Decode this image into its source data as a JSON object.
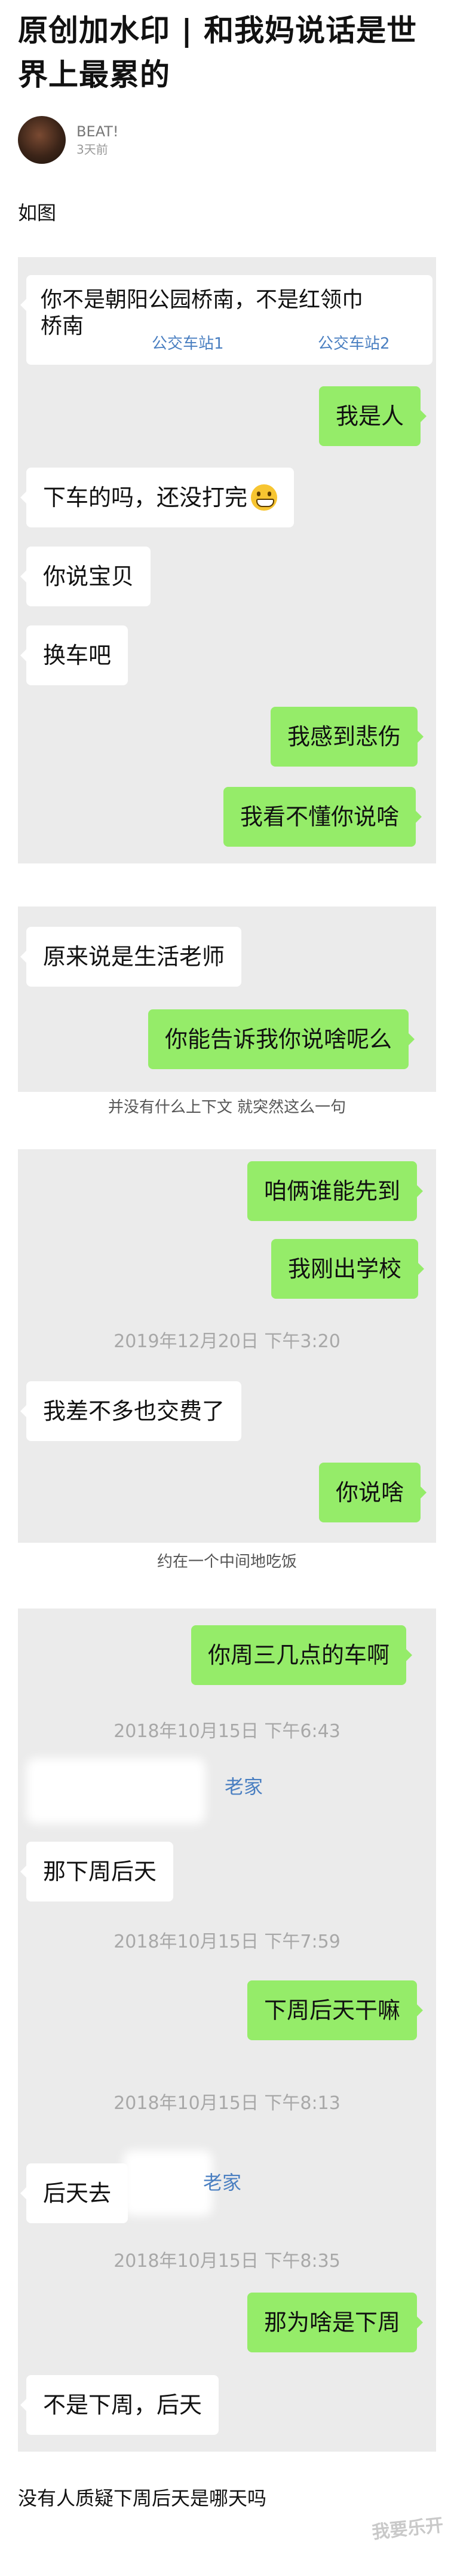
{
  "article": {
    "title_line1": "原创加水印 | 和我妈说话是世",
    "title_line2": "界上最累的",
    "author": "BEAT!",
    "time": "3天前",
    "intro": "如图"
  },
  "chat1": {
    "first_line1": "你不是朝阳公园桥南，不是红领巾",
    "first_line2": "桥南",
    "link1": "公交车站1",
    "link2": "公交车站2",
    "m1": "我是人",
    "m2": "下车的吗，还没打完",
    "m3": "你说宝贝",
    "m4": "换车吧",
    "m5": "我感到悲伤",
    "m6": "我看不懂你说啥"
  },
  "chat2": {
    "m1": "原来说是生活老师",
    "m2": "你能告诉我你说啥呢么"
  },
  "caption2": "并没有什么上下文 就突然这么一句",
  "chat3": {
    "m1": "咱俩谁能先到",
    "m2": "我刚出学校",
    "ts1": "2019年12月20日 下午3:20",
    "m3": "我差不多也交费了",
    "m4": "你说啥"
  },
  "caption3": "约在一个中间地吃饭",
  "chat4": {
    "m1": "你周三几点的车啊",
    "ts1": "2018年10月15日 下午6:43",
    "link1": "老家",
    "m2": "那下周后天",
    "ts2": "2018年10月15日 下午7:59",
    "m3": "下周后天干嘛",
    "ts3": "2018年10月15日 下午8:13",
    "m4": "后天去",
    "link2": "老家",
    "ts4": "2018年10月15日 下午8:35",
    "m5": "那为啥是下周",
    "m6": "不是下周，后天"
  },
  "bottom_text": "没有人质疑下周后天是哪天吗",
  "watermark": "我要乐开",
  "colors": {
    "chat_bg": "#ebebeb",
    "bubble_right": "#95ec69",
    "bubble_left": "#ffffff",
    "link": "#4a7fc1",
    "timestamp": "#a8a8a8"
  }
}
